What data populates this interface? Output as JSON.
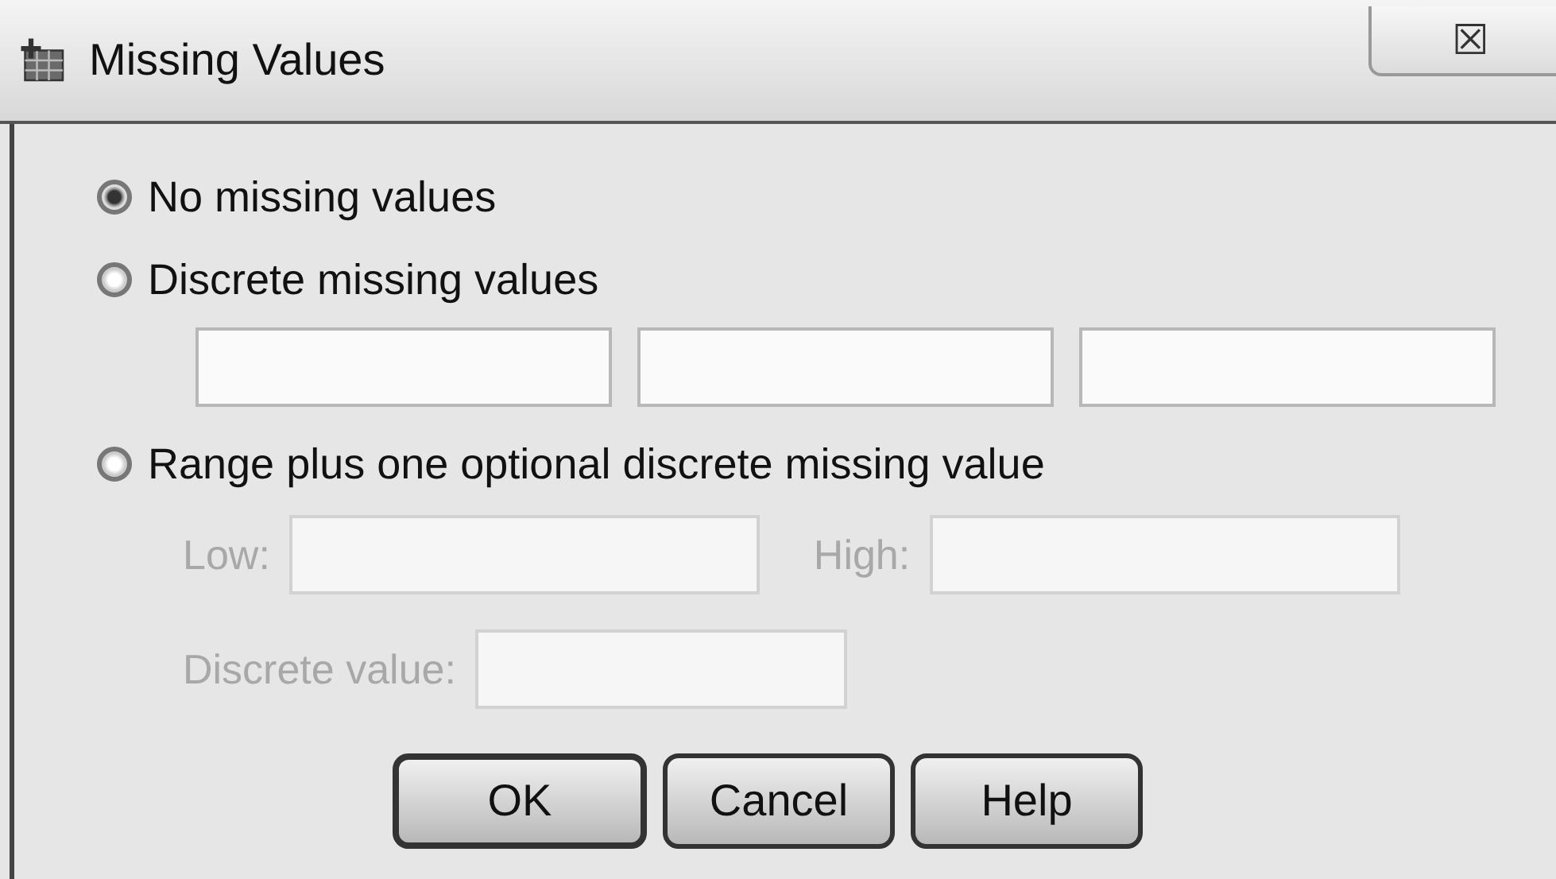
{
  "window": {
    "title": "Missing Values",
    "close": "☒"
  },
  "options": [
    {
      "label": "No missing values",
      "selected": true
    },
    {
      "label": "Discrete missing values",
      "selected": false
    },
    {
      "label": "Range plus one optional discrete missing value",
      "selected": false
    }
  ],
  "discrete_fields": [
    {
      "disabled": false
    },
    {
      "disabled": false
    },
    {
      "disabled": false
    }
  ],
  "range": {
    "low": {
      "label": "Low:",
      "disabled": true
    },
    "high": {
      "label": "High:",
      "disabled": true
    },
    "discrete": {
      "label": "Discrete value:",
      "disabled": true
    }
  },
  "buttons": [
    "OK",
    "Cancel",
    "Help"
  ]
}
